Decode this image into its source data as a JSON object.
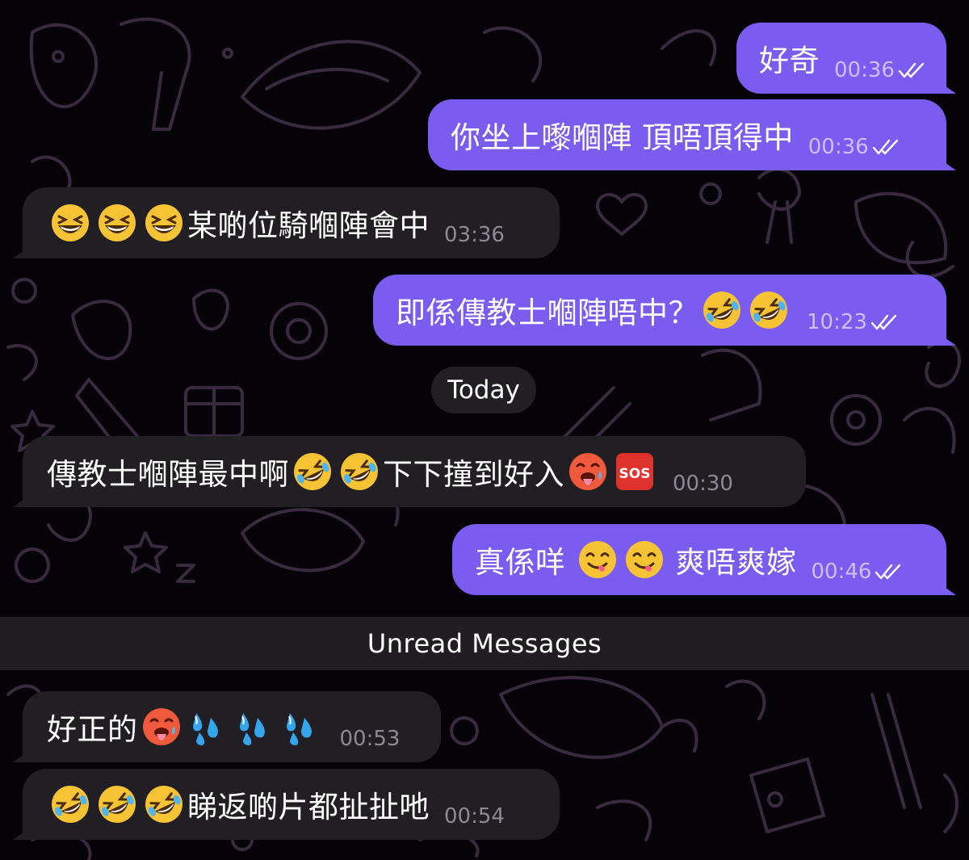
{
  "conversation": {
    "date_separator": "Today",
    "unread_divider": "Unread Messages",
    "messages": [
      {
        "direction": "out",
        "text": "好奇",
        "time": "00:36",
        "read": true
      },
      {
        "direction": "out",
        "text": "你坐上嚟嗰陣 頂唔頂得中",
        "time": "00:36",
        "read": true
      },
      {
        "direction": "in",
        "segments": [
          "grinning-squint-emoji",
          "grinning-squint-emoji",
          "grinning-squint-emoji",
          "某啲位騎嗰陣會中"
        ],
        "text": "某啲位騎嗰陣會中",
        "time": "03:36"
      },
      {
        "direction": "out",
        "text": "即係傳教士嗰陣唔中？",
        "emojis": [
          "rolling-laughing-emoji",
          "rolling-laughing-emoji"
        ],
        "time": "10:23",
        "read": true
      },
      {
        "direction": "in",
        "text_a": "傳教士嗰陣最中啊",
        "text_b": "下下撞到好入",
        "emojis_a": [
          "rolling-laughing-emoji",
          "rolling-laughing-emoji"
        ],
        "emojis_b": [
          "hot-face-emoji",
          "sos-button-emoji"
        ],
        "time": "00:30"
      },
      {
        "direction": "out",
        "text_a": "真係咩",
        "text_b": "爽唔爽嫁",
        "emojis": [
          "yum-face-emoji",
          "yum-face-emoji"
        ],
        "time": "00:46",
        "read": true
      },
      {
        "direction": "in",
        "text": "好正的",
        "emojis": [
          "hot-face-emoji",
          "sweat-droplets-emoji",
          "sweat-droplets-emoji",
          "sweat-droplets-emoji"
        ],
        "time": "00:53"
      },
      {
        "direction": "in",
        "text": "睇返啲片都扯扯吔",
        "emojis": [
          "rolling-laughing-emoji",
          "rolling-laughing-emoji",
          "rolling-laughing-emoji"
        ],
        "time": "00:54"
      }
    ]
  },
  "colors": {
    "background": "#050308",
    "outgoing_bubble": "#7b5cf0",
    "incoming_bubble": "#221f24",
    "doodle_stroke": "#3a2a40"
  }
}
